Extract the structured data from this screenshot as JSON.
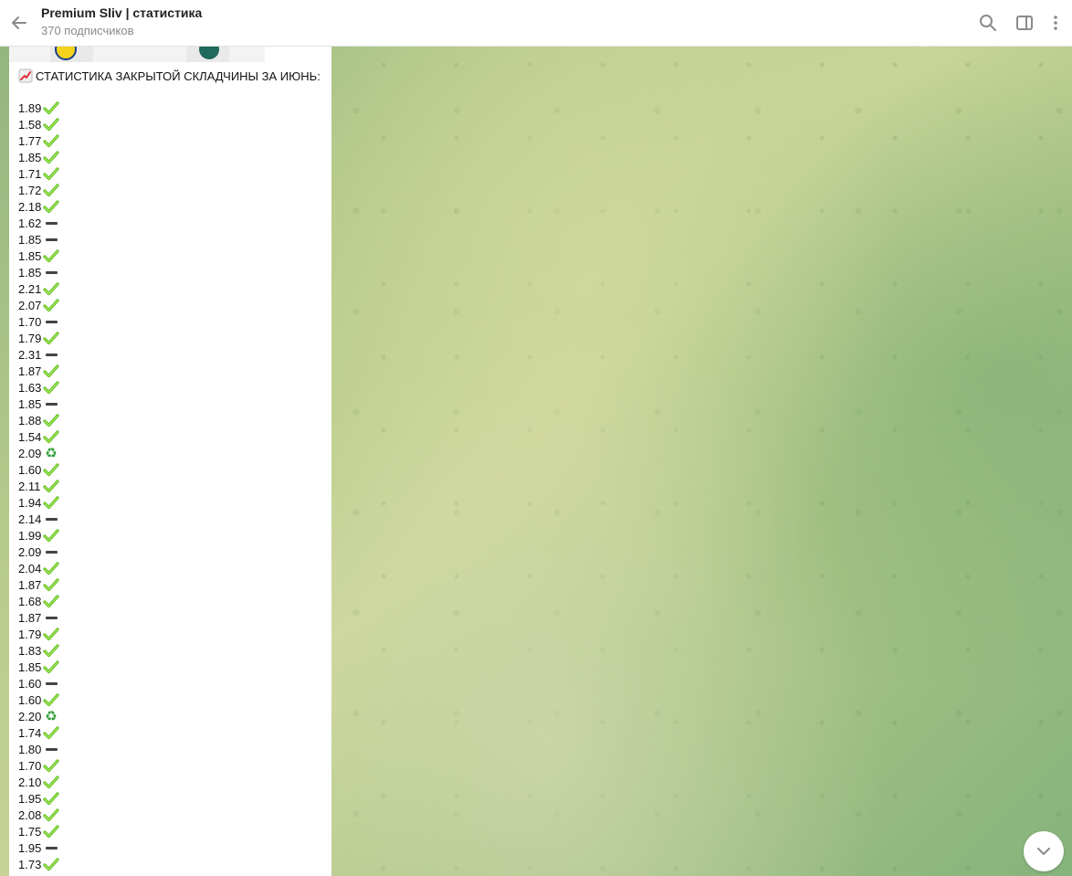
{
  "header": {
    "title": "Premium Sliv | статистика",
    "subtitle": "370 подписчиков"
  },
  "icons": {
    "back": "arrow-left-icon",
    "search": "search-icon",
    "sidebar": "sidebar-toggle-icon",
    "menu": "more-vertical-icon",
    "scroll_down": "chevron-down-icon"
  },
  "message": {
    "heading": "СТАТИСТИКА ЗАКРЫТОЙ СКЛАДЧИНЫ ЗА ИЮНЬ:",
    "heading_icon": "chart-increasing-icon",
    "rows": [
      {
        "value": "1.89",
        "status": "win"
      },
      {
        "value": "1.58",
        "status": "win"
      },
      {
        "value": "1.77",
        "status": "win"
      },
      {
        "value": "1.85",
        "status": "win"
      },
      {
        "value": "1.71",
        "status": "win"
      },
      {
        "value": "1.72",
        "status": "win"
      },
      {
        "value": "2.18",
        "status": "win"
      },
      {
        "value": "1.62",
        "status": "loss"
      },
      {
        "value": "1.85",
        "status": "loss"
      },
      {
        "value": "1.85",
        "status": "win"
      },
      {
        "value": "1.85",
        "status": "loss"
      },
      {
        "value": "2.21",
        "status": "win"
      },
      {
        "value": "2.07",
        "status": "win"
      },
      {
        "value": "1.70",
        "status": "loss"
      },
      {
        "value": "1.79",
        "status": "win"
      },
      {
        "value": "2.31",
        "status": "loss"
      },
      {
        "value": "1.87",
        "status": "win"
      },
      {
        "value": "1.63",
        "status": "win"
      },
      {
        "value": "1.85",
        "status": "loss"
      },
      {
        "value": "1.88",
        "status": "win"
      },
      {
        "value": "1.54",
        "status": "win"
      },
      {
        "value": "2.09",
        "status": "refund"
      },
      {
        "value": "1.60",
        "status": "win"
      },
      {
        "value": "2.11",
        "status": "win"
      },
      {
        "value": "1.94",
        "status": "win"
      },
      {
        "value": "2.14",
        "status": "loss"
      },
      {
        "value": "1.99",
        "status": "win"
      },
      {
        "value": "2.09",
        "status": "loss"
      },
      {
        "value": "2.04",
        "status": "win"
      },
      {
        "value": "1.87",
        "status": "win"
      },
      {
        "value": "1.68",
        "status": "win"
      },
      {
        "value": "1.87",
        "status": "loss"
      },
      {
        "value": "1.79",
        "status": "win"
      },
      {
        "value": "1.83",
        "status": "win"
      },
      {
        "value": "1.85",
        "status": "win"
      },
      {
        "value": "1.60",
        "status": "loss"
      },
      {
        "value": "1.60",
        "status": "win"
      },
      {
        "value": "2.20",
        "status": "refund"
      },
      {
        "value": "1.74",
        "status": "win"
      },
      {
        "value": "1.80",
        "status": "loss"
      },
      {
        "value": "1.70",
        "status": "win"
      },
      {
        "value": "2.10",
        "status": "win"
      },
      {
        "value": "1.95",
        "status": "win"
      },
      {
        "value": "2.08",
        "status": "win"
      },
      {
        "value": "1.75",
        "status": "win"
      },
      {
        "value": "1.95",
        "status": "loss"
      },
      {
        "value": "1.73",
        "status": "win"
      }
    ]
  },
  "colors": {
    "check": "#5fbf1f",
    "minus": "#444444",
    "recycle": "#2f9e3a",
    "header_bg": "#ffffff",
    "message_bg": "#ffffff"
  }
}
